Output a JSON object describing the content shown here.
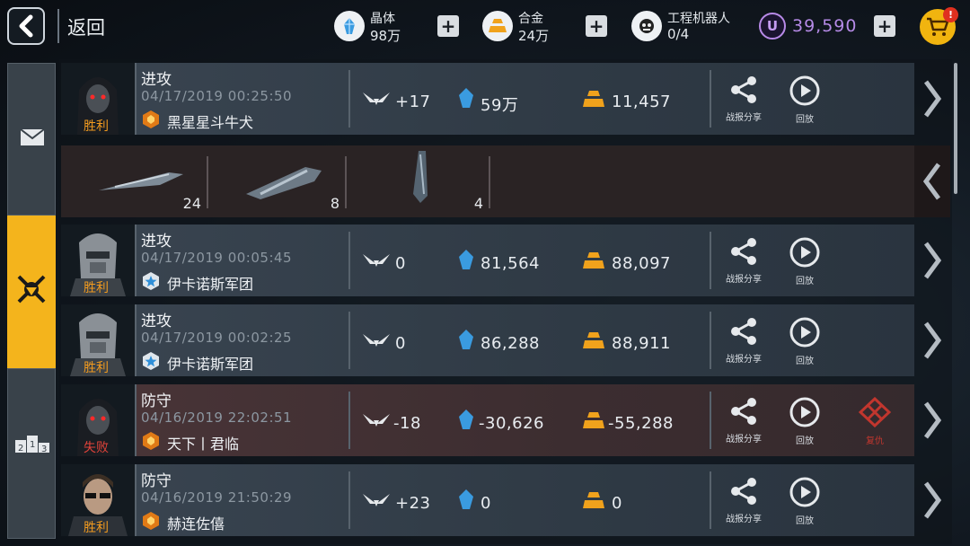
{
  "header": {
    "back_label": "返回",
    "resources": [
      {
        "name": "晶体",
        "value": "98万"
      },
      {
        "name": "合金",
        "value": "24万"
      },
      {
        "name": "工程机器人",
        "value": "0/4"
      }
    ],
    "currency_symbol": "U",
    "currency_value": "39,590",
    "cart_badge": "!"
  },
  "tabs": [
    {
      "id": "mail",
      "icon": "mail-icon",
      "active": false
    },
    {
      "id": "battle",
      "icon": "crossed-swords-icon",
      "active": true
    },
    {
      "id": "ranking",
      "icon": "podium-icon",
      "active": false
    }
  ],
  "colors": {
    "accent": "#f4b41c",
    "crystal": "#4aa8e8",
    "alloy": "#f0a21c",
    "victory": "#f29b1f",
    "defeat": "#e2433a",
    "premium": "#b58ae6"
  },
  "records": [
    {
      "kind": "进攻",
      "time": "04/17/2019 00:25:50",
      "opponent": "黑星星斗牛犬",
      "badge": "gold-rank-badge",
      "status": "胜利",
      "wings": "+17",
      "crystal": "59万",
      "alloy": "11,457",
      "share": "战报分享",
      "replay": "回放",
      "chevron": "‹"
    },
    {
      "kind": "进攻",
      "time": "04/17/2019 00:05:45",
      "opponent": "伊卡诺斯军团",
      "badge": "blue-star-badge",
      "status": "胜利",
      "wings": "0",
      "crystal": "81,564",
      "alloy": "88,097",
      "share": "战报分享",
      "replay": "回放"
    },
    {
      "kind": "进攻",
      "time": "04/17/2019 00:02:25",
      "opponent": "伊卡诺斯军团",
      "badge": "blue-star-badge",
      "status": "胜利",
      "wings": "0",
      "crystal": "86,288",
      "alloy": "88,911",
      "share": "战报分享",
      "replay": "回放"
    },
    {
      "kind": "防守",
      "time": "04/16/2019 22:02:51",
      "opponent": "天下丨君临",
      "badge": "gold-rank-badge",
      "status": "失败",
      "wings": "-18",
      "crystal": "-30,626",
      "alloy": "-55,288",
      "share": "战报分享",
      "replay": "回放",
      "revenge": "复仇"
    },
    {
      "kind": "防守",
      "time": "04/16/2019 21:50:29",
      "opponent": "赫连佐僖",
      "badge": "gold-rank-badge",
      "status": "胜利",
      "wings": "+23",
      "crystal": "0",
      "alloy": "0",
      "share": "战报分享",
      "replay": "回放"
    }
  ],
  "fleet": [
    {
      "ship": "frigate",
      "count": "24"
    },
    {
      "ship": "cruiser",
      "count": "8"
    },
    {
      "ship": "battleship",
      "count": "4"
    }
  ]
}
